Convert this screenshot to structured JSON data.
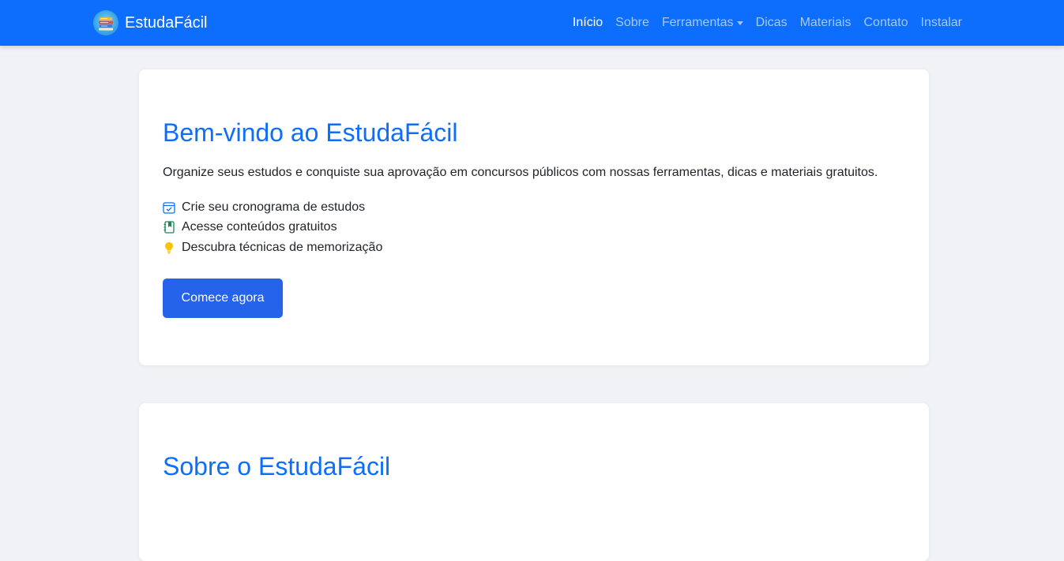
{
  "brand": {
    "name": "EstudaFácil",
    "logo_icon": "books-stack-icon"
  },
  "nav": {
    "items": [
      {
        "label": "Início",
        "active": true
      },
      {
        "label": "Sobre",
        "active": false
      },
      {
        "label": "Ferramentas",
        "active": false,
        "dropdown": true
      },
      {
        "label": "Dicas",
        "active": false
      },
      {
        "label": "Materiais",
        "active": false
      },
      {
        "label": "Contato",
        "active": false
      },
      {
        "label": "Instalar",
        "active": false
      }
    ]
  },
  "hero": {
    "title": "Bem-vindo ao EstudaFácil",
    "text": "Organize seus estudos e conquiste sua aprovação em concursos públicos com nossas ferramentas, dicas e materiais gratuitos.",
    "features": [
      {
        "icon": "calendar-check-icon",
        "label": "Crie seu cronograma de estudos"
      },
      {
        "icon": "journal-bookmark-icon",
        "label": "Acesse conteúdos gratuitos"
      },
      {
        "icon": "lightbulb-icon",
        "label": "Descubra técnicas de memorização"
      }
    ],
    "cta_label": "Comece agora"
  },
  "about": {
    "title": "Sobre o EstudaFácil"
  },
  "colors": {
    "navbar": "#0d6efd",
    "accent": "#0d6efd",
    "button": "#2563eb",
    "page_bg": "#f0f2f5",
    "card_bg": "#ffffff",
    "icon_blue": "#0d6efd",
    "icon_green": "#198754",
    "icon_yellow": "#ffc107"
  }
}
